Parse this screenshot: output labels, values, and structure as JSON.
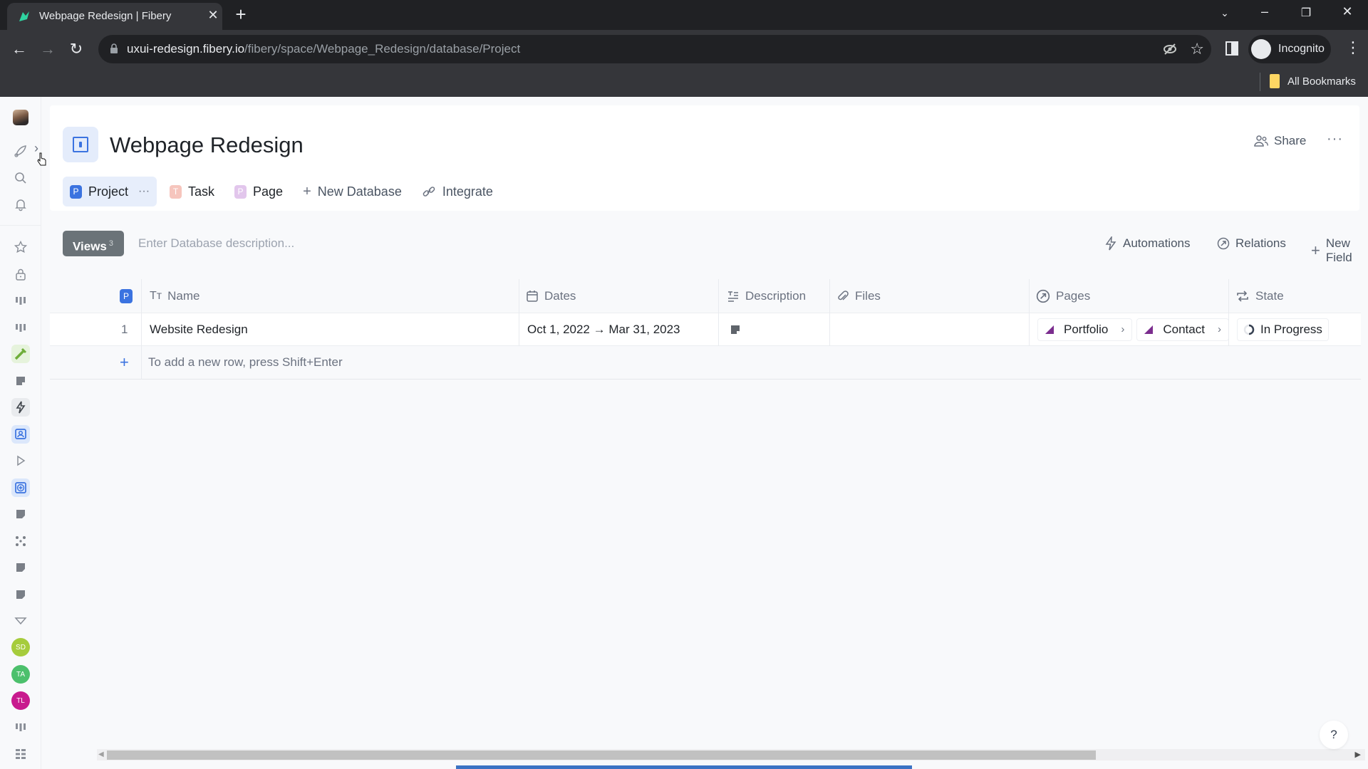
{
  "browser": {
    "tab_title": "Webpage Redesign | Fibery",
    "url_host": "uxui-redesign.fibery.io",
    "url_path": "/fibery/space/Webpage_Redesign/database/Project",
    "profile_label": "Incognito",
    "bookmarks_label": "All Bookmarks",
    "icons": [
      "back-icon",
      "forward-icon",
      "reload-icon",
      "lock-icon",
      "eye-off-icon",
      "star-icon",
      "side-panel-icon",
      "incognito-icon",
      "kebab-menu-icon"
    ]
  },
  "sidebar": {
    "items": [
      {
        "icon": "user-avatar"
      },
      {
        "icon": "rocket-icon"
      },
      {
        "icon": "search-icon"
      },
      {
        "icon": "bell-icon"
      },
      {
        "icon": "star-icon"
      },
      {
        "icon": "lock-icon"
      },
      {
        "icon": "board-icon"
      },
      {
        "icon": "board-icon"
      },
      {
        "icon": "screw-icon"
      },
      {
        "icon": "note-icon"
      },
      {
        "icon": "lightning-icon"
      },
      {
        "icon": "contact-card-icon"
      },
      {
        "icon": "play-outline-icon"
      },
      {
        "icon": "plus-square-icon"
      },
      {
        "icon": "note-icon"
      },
      {
        "icon": "scatter-icon"
      },
      {
        "icon": "note-icon"
      },
      {
        "icon": "note-icon"
      },
      {
        "icon": "triangle-down-icon"
      },
      {
        "icon": "board-icon"
      },
      {
        "icon": "grid-icon"
      }
    ],
    "avatars": [
      {
        "initials": "SD",
        "color": "#a6cc3c"
      },
      {
        "initials": "TA",
        "color": "#4cc06c"
      },
      {
        "initials": "TL",
        "color": "#c81a8e"
      }
    ]
  },
  "header": {
    "title": "Webpage Redesign",
    "share_label": "Share",
    "more_label": "···"
  },
  "db_tabs": [
    {
      "label": "Project",
      "badge": "P",
      "badge_color": "#3b73e0",
      "active": true
    },
    {
      "label": "Task",
      "badge": "T",
      "badge_color": "#f6c5bd"
    },
    {
      "label": "Page",
      "badge": "P",
      "badge_color": "#e2c6ec"
    },
    {
      "label": "New Database"
    },
    {
      "label": "Integrate"
    }
  ],
  "views": {
    "label": "Views",
    "count": "3",
    "description_placeholder": "Enter Database description...",
    "actions": [
      "Automations",
      "Relations",
      "New Field"
    ]
  },
  "table": {
    "header_badge": "P",
    "columns": [
      "Name",
      "Dates",
      "Description",
      "Files",
      "Pages",
      "State"
    ],
    "rows": [
      {
        "index": "1",
        "name": "Website Redesign",
        "dates": "Oct 1, 2022 → Mar 31, 2023",
        "description_icon": "note-icon",
        "files": "",
        "pages": [
          "Portfolio",
          "Contact"
        ],
        "state": "In Progress"
      }
    ],
    "add_row_hint": "To add a new row, press Shift+Enter"
  },
  "help_label": "?"
}
